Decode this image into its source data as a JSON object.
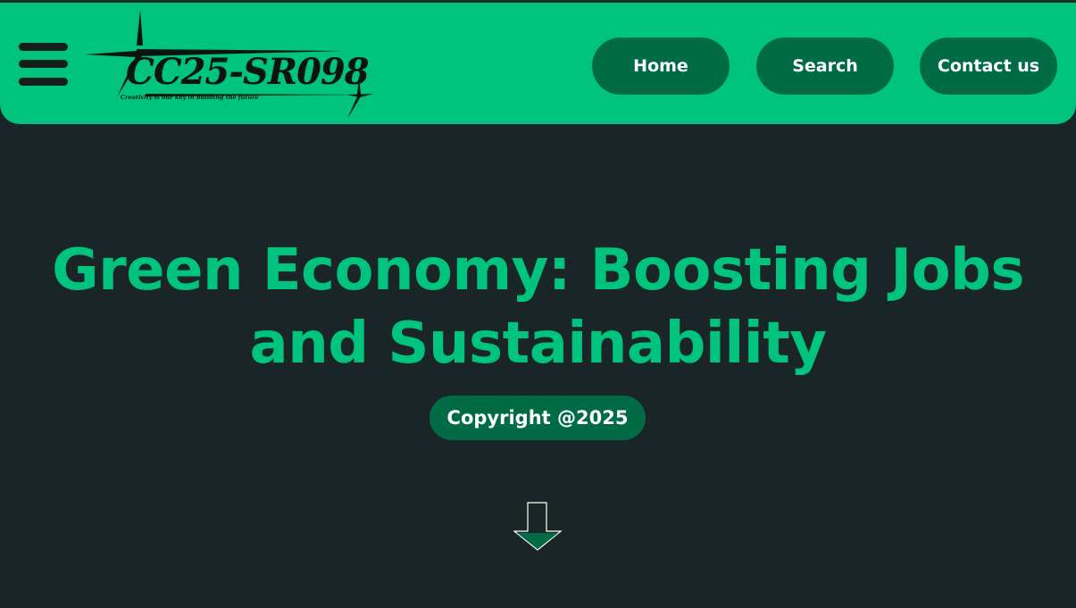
{
  "header": {
    "logo_text": "CC25-SR098",
    "logo_tagline": "Creativity is our key in building the future",
    "nav": {
      "home_label": "Home",
      "search_label": "Search",
      "contact_label": "Contact us"
    }
  },
  "hero": {
    "title_line1": "Green Economy: Boosting Jobs",
    "title_line2": "and Sustainability",
    "copyright": "Copyright @2025"
  },
  "icons": {
    "menu": "hamburger-menu-icon",
    "scroll": "arrow-down-icon"
  },
  "colors": {
    "accent": "#00c47d",
    "button": "#006b44",
    "background": "#1a2527",
    "text_on_button": "#ffffff"
  }
}
